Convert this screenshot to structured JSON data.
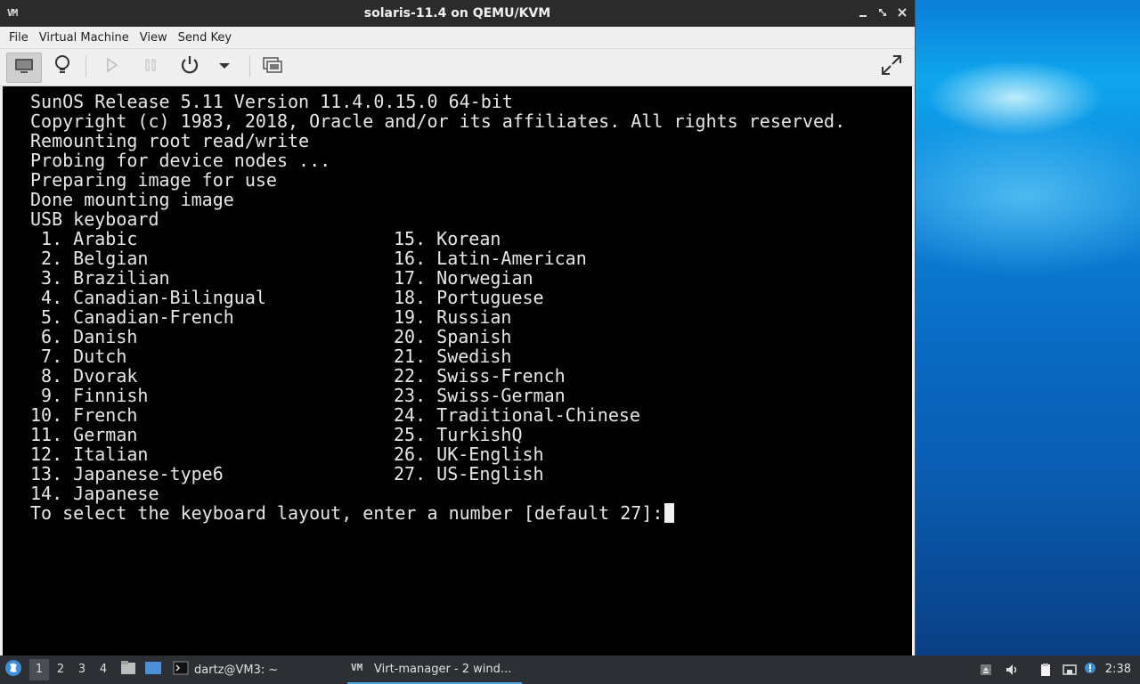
{
  "window": {
    "title": "solaris-11.4 on QEMU/KVM",
    "app_icon_text": "VM",
    "buttons": [
      "minimize",
      "maximize",
      "close"
    ]
  },
  "menu": {
    "items": [
      "File",
      "Virtual Machine",
      "View",
      "Send Key"
    ]
  },
  "toolbar": {
    "icons": [
      "console-icon",
      "details-bulb-icon",
      "run-icon",
      "pause-icon",
      "power-icon",
      "power-menu-icon",
      "snapshot-icon",
      "fullscreen-icon"
    ]
  },
  "console": {
    "boot_lines": [
      "SunOS Release 5.11 Version 11.4.0.15.0 64-bit",
      "Copyright (c) 1983, 2018, Oracle and/or its affiliates. All rights reserved.",
      "Remounting root read/write",
      "Probing for device nodes ...",
      "Preparing image for use",
      "Done mounting image",
      "USB keyboard"
    ],
    "layouts_left": [
      " 1. Arabic",
      " 2. Belgian",
      " 3. Brazilian",
      " 4. Canadian-Bilingual",
      " 5. Canadian-French",
      " 6. Danish",
      " 7. Dutch",
      " 8. Dvorak",
      " 9. Finnish",
      "10. French",
      "11. German",
      "12. Italian",
      "13. Japanese-type6",
      "14. Japanese"
    ],
    "layouts_right": [
      "15. Korean",
      "16. Latin-American",
      "17. Norwegian",
      "18. Portuguese",
      "19. Russian",
      "20. Spanish",
      "21. Swedish",
      "22. Swiss-French",
      "23. Swiss-German",
      "24. Traditional-Chinese",
      "25. TurkishQ",
      "26. UK-English",
      "27. US-English"
    ],
    "prompt": "To select the keyboard layout, enter a number [default 27]:"
  },
  "taskbar": {
    "workspaces": [
      "1",
      "2",
      "3",
      "4"
    ],
    "active_workspace": "1",
    "tasks": [
      {
        "label": "dartz@VM3: ~",
        "icon": "terminal-icon"
      },
      {
        "label": "Virt-manager - 2 wind...",
        "icon": "virt-manager-icon"
      }
    ],
    "clock": "2:38"
  },
  "colors": {
    "titlebar": "#2b2b2b",
    "console_bg": "#000000",
    "console_fg": "#e6e6e6",
    "taskbar": "#2c2f34",
    "accent": "#4aa3df"
  }
}
